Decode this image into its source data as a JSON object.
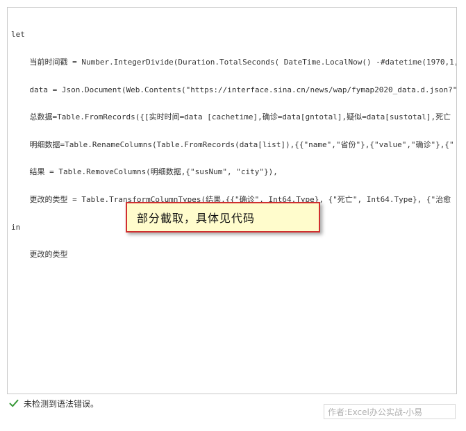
{
  "editor": {
    "lines": [
      "let",
      "    当前时间戳 = Number.IntegerDivide(Duration.TotalSeconds( DateTime.LocalNow() -#datetime(1970,1,",
      "    data = Json.Document(Web.Contents(\"https://interface.sina.cn/news/wap/fymap2020_data.d.json?\"&",
      "    总数据=Table.FromRecords({[实时时间=data [cachetime],确诊=data[gntotal],疑似=data[sustotal],死亡",
      "    明细数据=Table.RenameColumns(Table.FromRecords(data[list]),{{\"name\",\"省份\"},{\"value\",\"确诊\"},{\"",
      "    结果 = Table.RemoveColumns(明细数据,{\"susNum\", \"city\"}),",
      "    更改的类型 = Table.TransformColumnTypes(结果,{{\"确诊\", Int64.Type}, {\"死亡\", Int64.Type}, {\"治愈",
      "in",
      "    更改的类型"
    ]
  },
  "callout": {
    "text": "部分截取，具体见代码",
    "border_color": "#d02f2f",
    "background_color": "#fffccc"
  },
  "status": {
    "icon": "check-icon",
    "icon_color": "#3a9a3a",
    "text": "未检测到语法错误。"
  },
  "watermark": {
    "text": "作者:Excel办公实战-小易"
  }
}
